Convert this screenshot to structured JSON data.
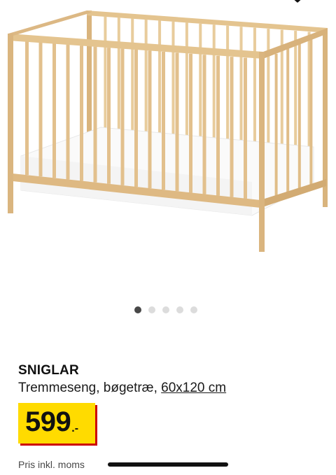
{
  "icons": {
    "top": "chevron-down-icon"
  },
  "image": {
    "subject": "crib-image"
  },
  "carousel": {
    "count": 5,
    "active_index": 0
  },
  "product": {
    "name": "SNIGLAR",
    "description": "Tremmeseng, bøgetræ, ",
    "size": "60x120 cm"
  },
  "price": {
    "amount": "599",
    "suffix": ".-",
    "note": "Pris inkl. moms"
  },
  "colors": {
    "price_bg": "#ffdb00",
    "price_shadow": "#cc0008",
    "wood": "#e2c08d",
    "mattress": "#fafafa"
  }
}
